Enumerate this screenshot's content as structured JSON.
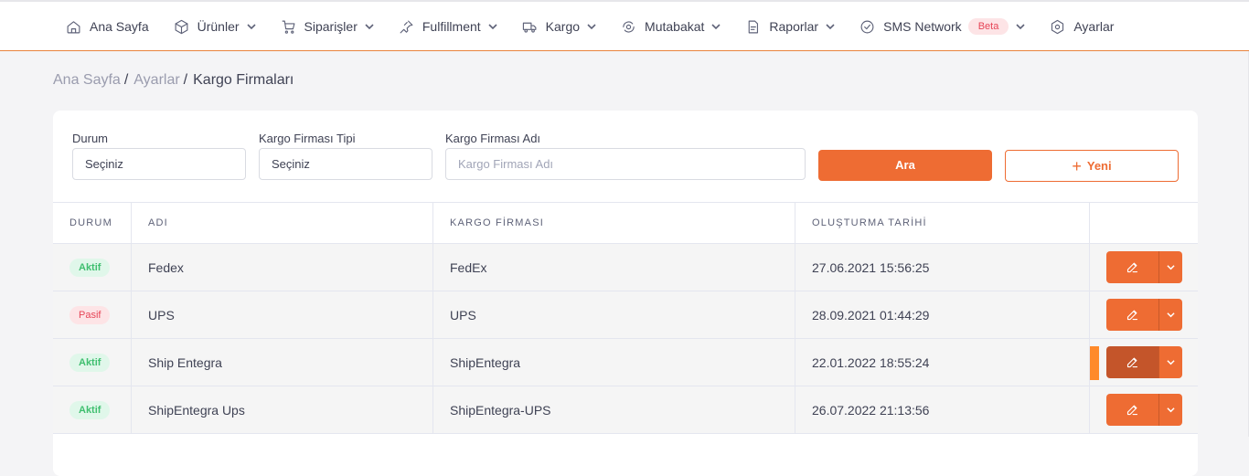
{
  "nav": {
    "items": [
      {
        "label": "Ana Sayfa",
        "icon": "home-icon",
        "has_dropdown": false
      },
      {
        "label": "Ürünler",
        "icon": "box-icon",
        "has_dropdown": true
      },
      {
        "label": "Siparişler",
        "icon": "cart-icon",
        "has_dropdown": true
      },
      {
        "label": "Fulfillment",
        "icon": "pin-icon",
        "has_dropdown": true
      },
      {
        "label": "Kargo",
        "icon": "truck-icon",
        "has_dropdown": true
      },
      {
        "label": "Mutabakat",
        "icon": "reconcile-icon",
        "has_dropdown": true
      },
      {
        "label": "Raporlar",
        "icon": "report-icon",
        "has_dropdown": true
      },
      {
        "label": "SMS Network",
        "icon": "check-circle-icon",
        "has_dropdown": true,
        "badge": "Beta"
      },
      {
        "label": "Ayarlar",
        "icon": "settings-icon",
        "has_dropdown": false
      }
    ]
  },
  "breadcrumb": {
    "items": [
      "Ana Sayfa",
      "Ayarlar"
    ],
    "separator": "/",
    "current": "Kargo Firmaları"
  },
  "filters": {
    "status": {
      "label": "Durum",
      "value": "Seçiniz"
    },
    "type": {
      "label": "Kargo Firması Tipi",
      "value": "Seçiniz"
    },
    "name": {
      "label": "Kargo Firması Adı",
      "placeholder": "Kargo Firması Adı",
      "value": ""
    },
    "search_button": "Ara",
    "new_button": "Yeni"
  },
  "table": {
    "columns": [
      "DURUM",
      "ADI",
      "KARGO FİRMASI",
      "OLUŞTURMA TARİHİ",
      ""
    ],
    "rows": [
      {
        "status": "Aktif",
        "status_type": "active",
        "name": "Fedex",
        "company": "FedEx",
        "created": "27.06.2021 15:56:25"
      },
      {
        "status": "Pasif",
        "status_type": "passive",
        "name": "UPS",
        "company": "UPS",
        "created": "28.09.2021 01:44:29"
      },
      {
        "status": "Aktif",
        "status_type": "active",
        "name": "Ship Entegra",
        "company": "ShipEntegra",
        "created": "22.01.2022 18:55:24",
        "highlighted": true
      },
      {
        "status": "Aktif",
        "status_type": "active",
        "name": "ShipEntegra Ups",
        "company": "ShipEntegra-UPS",
        "created": "26.07.2022 21:13:56"
      }
    ]
  },
  "colors": {
    "accent": "#ee6c33",
    "accent_dark": "#c4552a",
    "active_bg": "#e0f7ea",
    "active_fg": "#3fbf6f",
    "passive_bg": "#fde4e6",
    "passive_fg": "#e64557",
    "page_bg": "#f4f4f6"
  }
}
